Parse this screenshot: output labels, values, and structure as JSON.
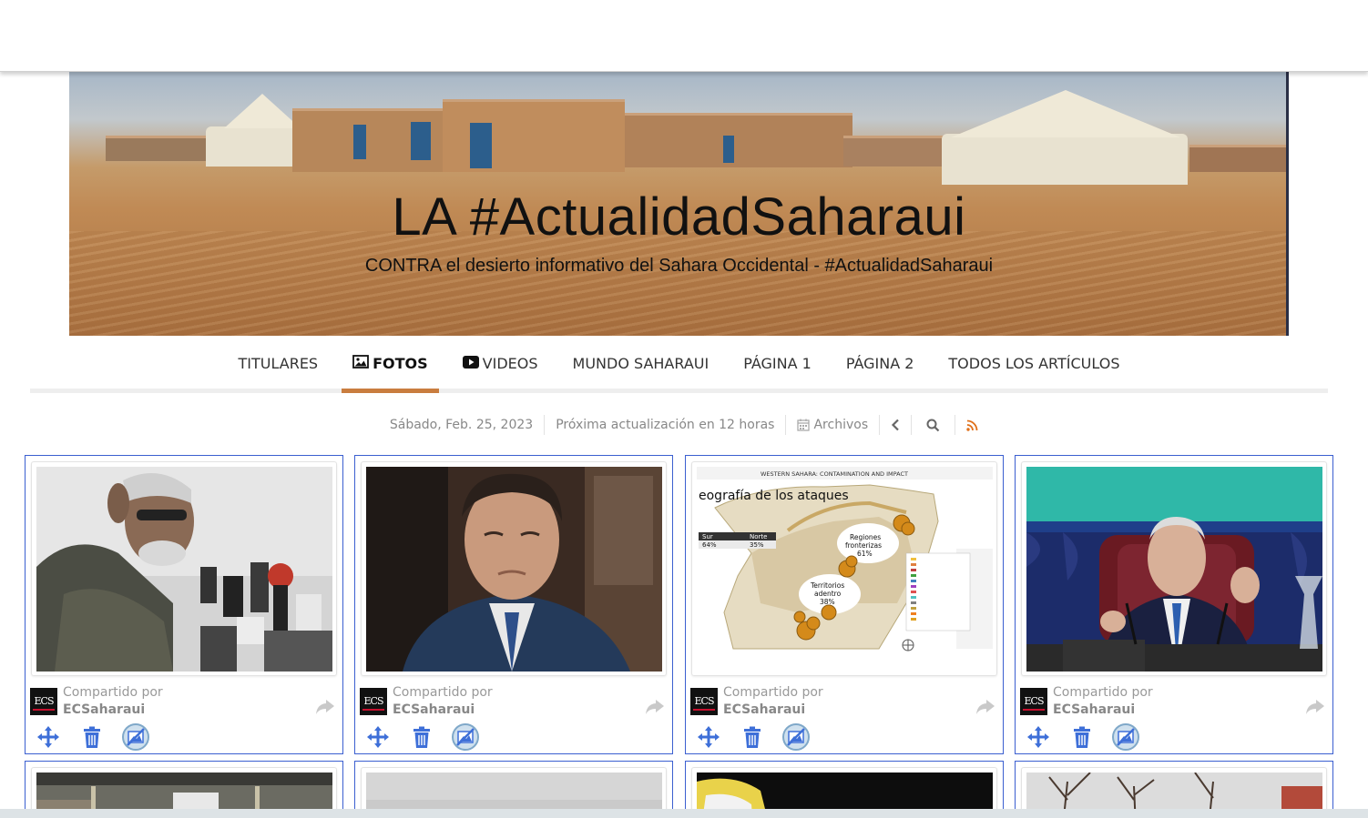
{
  "site": {
    "title": "LA #ActualidadSaharaui",
    "subtitle": "CONTRA el desierto informativo del Sahara Occidental - #ActualidadSaharaui"
  },
  "nav": {
    "items": [
      {
        "label": "TITULARES",
        "icon": ""
      },
      {
        "label": "FOTOS",
        "icon": "image-icon",
        "active": true
      },
      {
        "label": "VIDEOS",
        "icon": "play-icon"
      },
      {
        "label": "MUNDO SAHARAUI",
        "icon": ""
      },
      {
        "label": "PÁGINA 1",
        "icon": ""
      },
      {
        "label": "PÁGINA 2",
        "icon": ""
      },
      {
        "label": "TODOS LOS ARTÍCULOS",
        "icon": ""
      }
    ],
    "active_color": "#c97d3f"
  },
  "infobar": {
    "date": "Sábado, Feb. 25, 2023",
    "next_update": "Próxima actualización en 12 horas",
    "archives": "Archivos",
    "rss_color": "#e0701a"
  },
  "cards": [
    {
      "shared_label": "Compartido por",
      "author": "ECSaharaui",
      "avatar_text": "ECS",
      "image": "man-at-microphones"
    },
    {
      "shared_label": "Compartido por",
      "author": "ECSaharaui",
      "avatar_text": "ECS",
      "image": "man-in-suit"
    },
    {
      "shared_label": "Compartido por",
      "author": "ECSaharaui",
      "avatar_text": "ECS",
      "image": "western-sahara-map",
      "map_text": {
        "heading": "WESTERN SAHARA: CONTAMINATION AND IMPACT",
        "title": "eografía de los ataques",
        "col1": "Sur",
        "col2": "Norte",
        "val1": "64%",
        "val2": "35%",
        "region1": "Regiones",
        "region1b": "fronterizas",
        "region1c": "61%",
        "region2": "Territorios",
        "region2b": "adentro",
        "region2c": "38%"
      }
    },
    {
      "shared_label": "Compartido por",
      "author": "ECSaharaui",
      "avatar_text": "ECS",
      "image": "man-gesturing-at-podium"
    }
  ],
  "accent_blue": "#3b5fd0",
  "icon_blue": "#3e6fd8"
}
